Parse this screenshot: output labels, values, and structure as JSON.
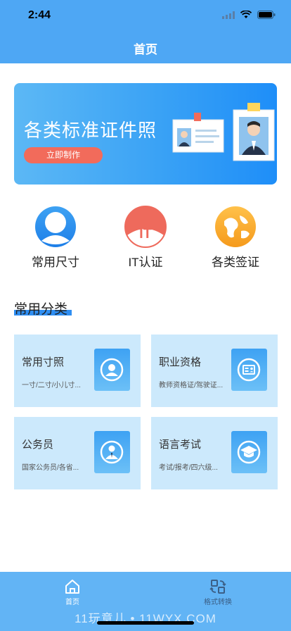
{
  "status_bar": {
    "time": "2:44"
  },
  "header": {
    "title": "首页"
  },
  "banner": {
    "title": "各类标准证件照",
    "button_label": "立即制作"
  },
  "categories": [
    {
      "label": "常用尺寸",
      "icon": "person-circle-icon"
    },
    {
      "label": "IT认证",
      "icon": "it-badge-icon"
    },
    {
      "label": "各类签证",
      "icon": "world-map-icon"
    }
  ],
  "section": {
    "title": "常用分类"
  },
  "cards": [
    {
      "title": "常用寸照",
      "subtitle": "一寸/二寸/小儿寸...",
      "icon": "portrait-icon"
    },
    {
      "title": "职业资格",
      "subtitle": "教师资格证/驾驶证...",
      "icon": "id-card-icon"
    },
    {
      "title": "公务员",
      "subtitle": "国家公务员/各省...",
      "icon": "official-icon"
    },
    {
      "title": "语言考试",
      "subtitle": "考试/报考/四六级...",
      "icon": "graduation-cap-icon"
    }
  ],
  "tabbar": {
    "items": [
      {
        "label": "首页",
        "icon": "home-icon",
        "active": true
      },
      {
        "label": "格式转换",
        "icon": "convert-icon",
        "active": false
      }
    ]
  },
  "watermark": "11玩意儿 • 11WYX.COM",
  "colors": {
    "primary": "#4ea7f4",
    "accent_button": "#f26b5b",
    "card_bg": "#cce9fc",
    "tabbar_bg": "#62b4f5"
  }
}
